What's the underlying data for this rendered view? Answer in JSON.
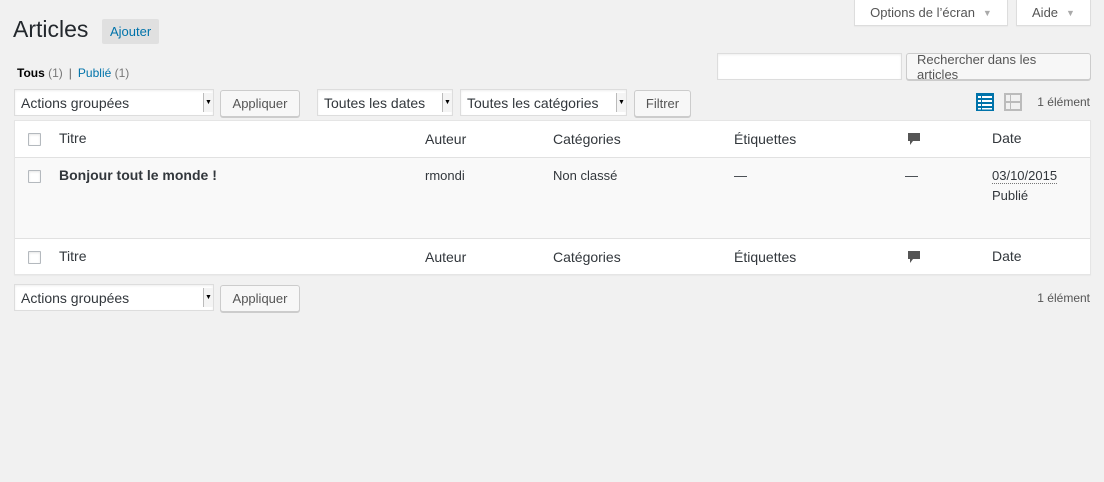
{
  "header": {
    "screen_options": "Options de l’écran",
    "help": "Aide",
    "page_title": "Articles",
    "add_new": "Ajouter"
  },
  "views": {
    "all_label": "Tous",
    "all_count": "(1)",
    "separator": "|",
    "published_label": "Publié",
    "published_count": "(1)"
  },
  "search": {
    "value": "",
    "button": "Rechercher dans les articles"
  },
  "tablenav_top": {
    "bulk_actions": "Actions groupées",
    "apply": "Appliquer",
    "dates_filter": "Toutes les dates",
    "categories_filter": "Toutes les catégories",
    "filter_button": "Filtrer",
    "items_count": "1 élément"
  },
  "table": {
    "columns": {
      "title": "Titre",
      "author": "Auteur",
      "categories": "Catégories",
      "tags": "Étiquettes",
      "comments_icon": "comment-bubble-icon",
      "date": "Date"
    },
    "rows": [
      {
        "title": "Bonjour tout le monde !",
        "author": "rmondi",
        "categories": "Non classé",
        "tags": "—",
        "comments": "—",
        "date": "03/10/2015",
        "status": "Publié"
      }
    ]
  },
  "tablenav_bottom": {
    "bulk_actions": "Actions groupées",
    "apply": "Appliquer",
    "items_count": "1 élément"
  },
  "colors": {
    "link": "#0073aa",
    "background": "#f1f1f1",
    "view_icon_active": "#0073aa"
  }
}
